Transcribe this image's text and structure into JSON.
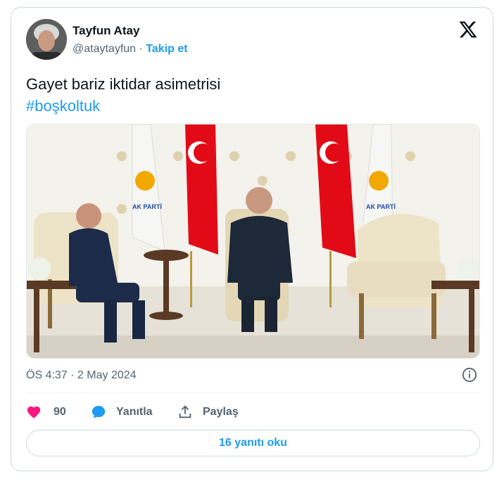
{
  "author": {
    "name": "Tayfun Atay",
    "handle": "@ataytayfun",
    "separator": "·",
    "follow_label": "Takip et"
  },
  "tweet": {
    "text": "Gayet bariz iktidar asimetrisi",
    "hashtag": "#boşkoltuk"
  },
  "photo": {
    "flag_text": "AK PARTİ"
  },
  "meta": {
    "timestamp": "ÖS 4:37 · 2 May 2024"
  },
  "actions": {
    "likes": "90",
    "reply_label": "Yanıtla",
    "share_label": "Paylaş"
  },
  "read_replies_label": "16 yanıtı oku",
  "colors": {
    "accent": "#1d9bf0",
    "like": "#f91880",
    "muted": "#536471"
  },
  "icons": {
    "brand": "x-logo-icon",
    "info": "info-icon",
    "like": "heart-icon",
    "reply": "speech-bubble-icon",
    "share": "share-upload-icon"
  }
}
